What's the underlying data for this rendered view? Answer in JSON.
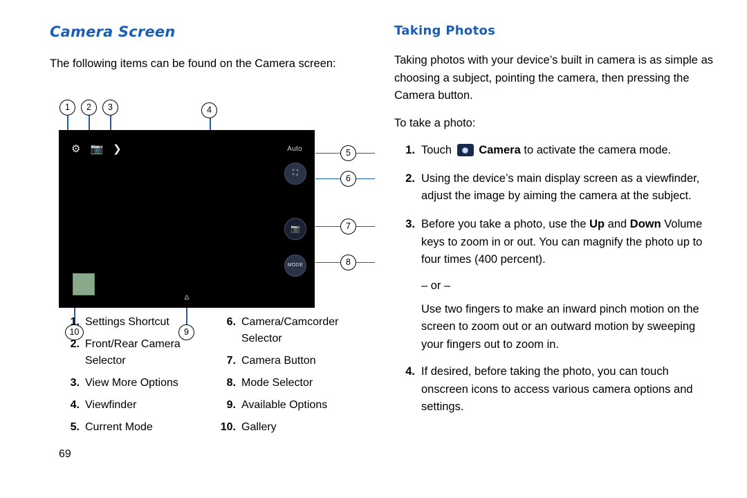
{
  "page_number": "69",
  "left": {
    "title": "Camera Screen",
    "intro": "The following items can be found on the Camera screen:",
    "camera_ui": {
      "settings_icon": "gear-icon",
      "switch_camera_icon": "camera-switch-icon",
      "more_options_icon": "chevron-right-icon",
      "mode_label": "Auto",
      "camcorder_icon": "camcorder-icon",
      "shutter_icon": "camera-icon",
      "mode_button_label": "MODE",
      "available_options_icon": "chevron-up-icon",
      "gallery_thumb": "gallery-thumbnail",
      "viewfinder_bg": "#000000",
      "accent_color": "#1a5fb4"
    },
    "callouts": [
      "1",
      "2",
      "3",
      "4",
      "5",
      "6",
      "7",
      "8",
      "9",
      "10"
    ],
    "legend_left": [
      {
        "num": "1.",
        "text": "Settings Shortcut"
      },
      {
        "num": "2.",
        "text": "Front/Rear Camera Selector"
      },
      {
        "num": "3.",
        "text": "View More Options"
      },
      {
        "num": "4.",
        "text": "Viewfinder"
      },
      {
        "num": "5.",
        "text": "Current Mode"
      }
    ],
    "legend_right": [
      {
        "num": "6.",
        "text": "Camera/Camcorder Selector"
      },
      {
        "num": "7.",
        "text": "Camera Button"
      },
      {
        "num": "8.",
        "text": "Mode Selector"
      },
      {
        "num": "9.",
        "text": "Available Options"
      },
      {
        "num": "10.",
        "text": "Gallery"
      }
    ]
  },
  "right": {
    "title": "Taking Photos",
    "intro": "Taking photos with your device’s built in camera is as simple as choosing a subject, pointing the camera, then pressing the Camera button.",
    "lead_in": "To take a photo:",
    "steps": [
      {
        "num": "1.",
        "pre": "Touch",
        "icon": "camera-app-icon",
        "bold": "Camera",
        "post": "to activate the camera mode."
      },
      {
        "num": "2.",
        "text": "Using the device’s main display screen as a viewfinder, adjust the image by aiming the camera at the subject."
      },
      {
        "num": "3.",
        "part1": "Before you take a photo, use the ",
        "bold1": "Up",
        "part2": " and ",
        "bold2": "Down",
        "part3": " Volume keys to zoom in or out. You can magnify the photo up to four times (400 percent)."
      },
      {
        "num": "4.",
        "text": "If desired, before taking the photo, you can touch onscreen icons to access various camera options and settings."
      }
    ],
    "or_text": "– or –",
    "pinch_text": "Use two fingers to make an inward pinch motion on the screen to zoom out or an outward motion by sweeping your fingers out to zoom in."
  }
}
